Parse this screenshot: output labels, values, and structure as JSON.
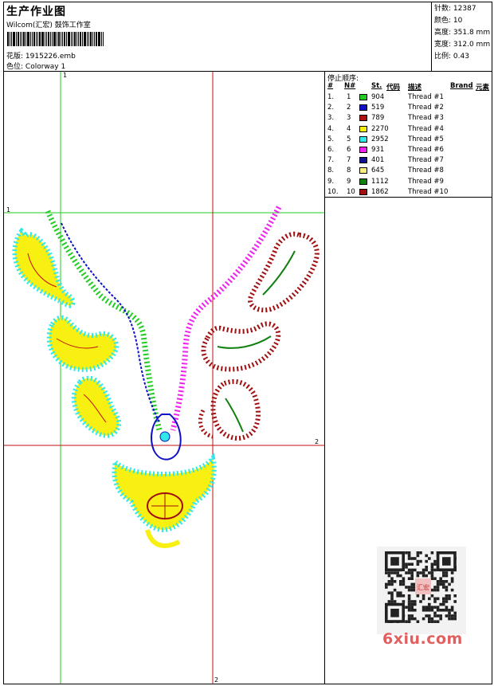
{
  "header": {
    "title": "生产作业图",
    "company": "Wilcom(汇宏) 鼓饰工作室",
    "design_label": "花版:",
    "design_value": "1915226.emb",
    "colorway_label": "色位:",
    "colorway_value": "Colorway 1"
  },
  "stats": [
    {
      "label": "针数:",
      "value": "12387"
    },
    {
      "label": "颜色:",
      "value": "10"
    },
    {
      "label": "高度:",
      "value": "351.8 mm"
    },
    {
      "label": "宽度:",
      "value": "312.0 mm"
    },
    {
      "label": "比例:",
      "value": "0.43"
    }
  ],
  "stop_panel": {
    "title": "停止顺序:",
    "columns": {
      "idx": "#",
      "no": "N#",
      "st": "St.",
      "code": "代码",
      "desc": "描述",
      "brand": "Brand",
      "element": "元素"
    },
    "rows": [
      {
        "idx": "1.",
        "no": "1",
        "color": "#22cc22",
        "st": "904",
        "desc": "Thread #1"
      },
      {
        "idx": "2.",
        "no": "2",
        "color": "#1010c8",
        "st": "519",
        "desc": "Thread #2"
      },
      {
        "idx": "3.",
        "no": "3",
        "color": "#b01010",
        "st": "789",
        "desc": "Thread #3"
      },
      {
        "idx": "4.",
        "no": "4",
        "color": "#f8f010",
        "st": "2270",
        "desc": "Thread #4"
      },
      {
        "idx": "5.",
        "no": "5",
        "color": "#30e8e8",
        "st": "2952",
        "desc": "Thread #5"
      },
      {
        "idx": "6.",
        "no": "6",
        "color": "#f020f0",
        "st": "931",
        "desc": "Thread #6"
      },
      {
        "idx": "7.",
        "no": "7",
        "color": "#101090",
        "st": "401",
        "desc": "Thread #7"
      },
      {
        "idx": "8.",
        "no": "8",
        "color": "#f8f080",
        "st": "645",
        "desc": "Thread #8"
      },
      {
        "idx": "9.",
        "no": "9",
        "color": "#108010",
        "st": "1112",
        "desc": "Thread #9"
      },
      {
        "idx": "10.",
        "no": "10",
        "color": "#a01010",
        "st": "1862",
        "desc": "Thread #10"
      }
    ]
  },
  "guides": {
    "v1": "1",
    "h1": "1",
    "h2": "2",
    "v2": "2"
  },
  "watermark": "6xiu.com",
  "qr_stamp": "汇宏"
}
